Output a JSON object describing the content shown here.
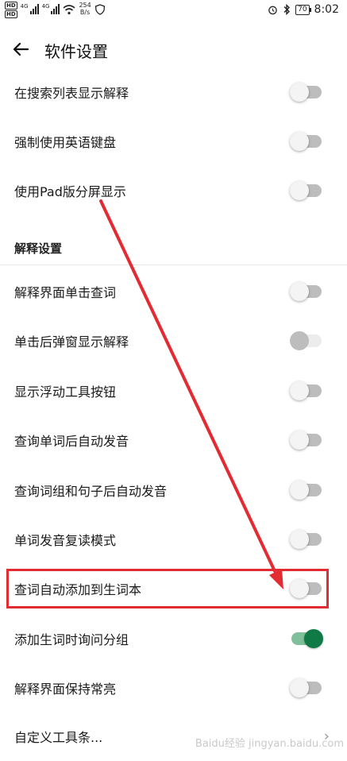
{
  "status_bar": {
    "hd1": "HD",
    "hd2": "HD",
    "sig1_label": "4G",
    "sig2_label": "4G",
    "speed_value": "254",
    "speed_unit": "B/s",
    "battery": "70",
    "time": "8:02"
  },
  "header": {
    "title": "软件设置"
  },
  "items_top": [
    {
      "label": "在搜索列表显示解释",
      "state": "off"
    },
    {
      "label": "强制使用英语键盘",
      "state": "off"
    },
    {
      "label": "使用Pad版分屏显示",
      "state": "off"
    }
  ],
  "section_title": "解释设置",
  "items_explain": [
    {
      "label": "解释界面单击查词",
      "state": "off"
    },
    {
      "label": "单击后弹窗显示解释",
      "state": "disabled"
    },
    {
      "label": "显示浮动工具按钮",
      "state": "off"
    },
    {
      "label": "查询单词后自动发音",
      "state": "off"
    },
    {
      "label": "查询词组和句子后自动发音",
      "state": "off"
    },
    {
      "label": "单词发音复读模式",
      "state": "off"
    },
    {
      "label": "查词自动添加到生词本",
      "state": "off"
    },
    {
      "label": "添加生词时询问分组",
      "state": "on"
    },
    {
      "label": "解释界面保持常亮",
      "state": "off"
    }
  ],
  "custom_toolbar": {
    "label": "自定义工具条..."
  },
  "watermark": "Baidu经验 jingyan.baidu.com",
  "colors": {
    "accent": "#0f7a45",
    "highlight": "#e22b32"
  }
}
